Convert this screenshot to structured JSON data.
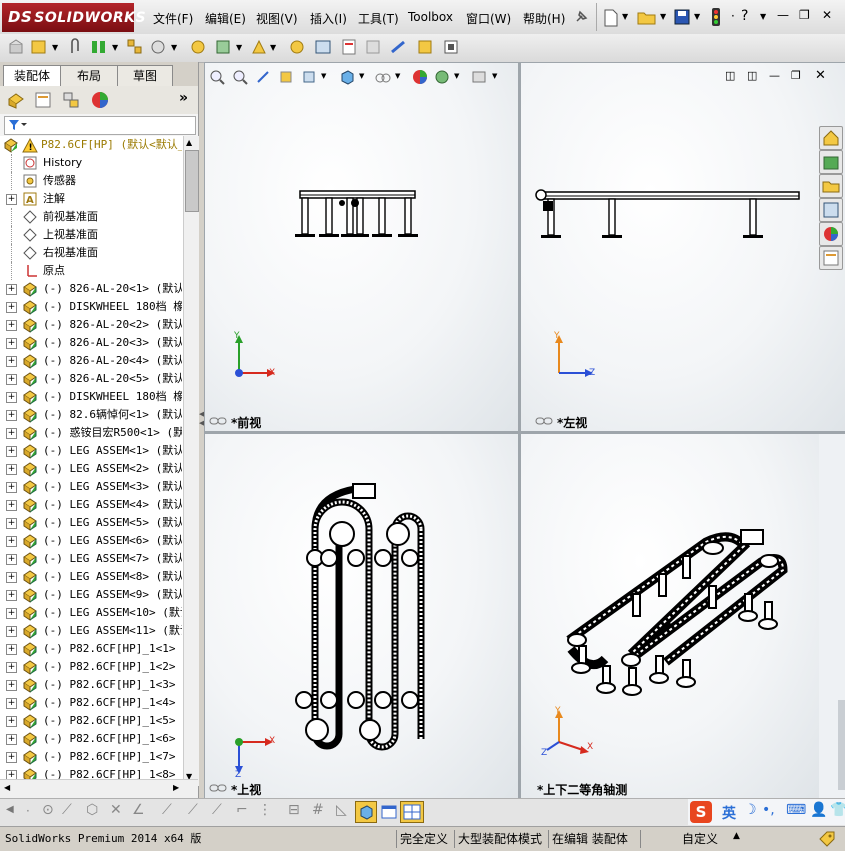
{
  "app": {
    "brand": "SOLIDWORKS",
    "brand_prefix": "DS"
  },
  "menu": [
    {
      "label": "文件(F)"
    },
    {
      "label": "编辑(E)"
    },
    {
      "label": "视图(V)"
    },
    {
      "label": "插入(I)"
    },
    {
      "label": "工具(T)"
    },
    {
      "label": "Toolbox"
    },
    {
      "label": "窗口(W)"
    },
    {
      "label": "帮助(H)"
    }
  ],
  "window_controls": {
    "help": "?",
    "minimize": "—",
    "restore": "❐",
    "close": "✕"
  },
  "panel_tabs": [
    {
      "label": "装配体"
    },
    {
      "label": "布局"
    },
    {
      "label": "草图"
    }
  ],
  "panel_more": "»",
  "tree": {
    "root": "P82.6CF[HP]  (默认<默认_",
    "items": [
      {
        "label": "History",
        "icon": "history-icon",
        "expand": ""
      },
      {
        "label": "传感器",
        "icon": "sensor-icon",
        "expand": ""
      },
      {
        "label": "注解",
        "icon": "annotation-icon",
        "expand": "+"
      },
      {
        "label": "前视基准面",
        "icon": "plane-icon",
        "expand": ""
      },
      {
        "label": "上视基准面",
        "icon": "plane-icon",
        "expand": ""
      },
      {
        "label": "右视基准面",
        "icon": "plane-icon",
        "expand": ""
      },
      {
        "label": "原点",
        "icon": "origin-icon",
        "expand": ""
      },
      {
        "label": "(-) 826-AL-20<1> (默认<",
        "icon": "part-icon",
        "expand": "+"
      },
      {
        "label": "(-) DISKWHEEL 180档 橡胶",
        "icon": "part-icon",
        "expand": "+"
      },
      {
        "label": "(-) 826-AL-20<2> (默认<",
        "icon": "part-icon",
        "expand": "+"
      },
      {
        "label": "(-) 826-AL-20<3> (默认<",
        "icon": "part-icon",
        "expand": "+"
      },
      {
        "label": "(-) 826-AL-20<4> (默认<",
        "icon": "part-icon",
        "expand": "+"
      },
      {
        "label": "(-) 826-AL-20<5> (默认<",
        "icon": "part-icon",
        "expand": "+"
      },
      {
        "label": "(-) DISKWHEEL 180档 橡胶",
        "icon": "part-icon",
        "expand": "+"
      },
      {
        "label": "(-) 82.6辆悼何<1> (默认",
        "icon": "part-icon",
        "expand": "+"
      },
      {
        "label": "(-) 惑铵目宏R500<1> (默",
        "icon": "part-icon",
        "expand": "+"
      },
      {
        "label": "(-) LEG ASSEM<1> (默认<",
        "icon": "part-icon",
        "expand": "+"
      },
      {
        "label": "(-) LEG ASSEM<2> (默认<",
        "icon": "part-icon",
        "expand": "+"
      },
      {
        "label": "(-) LEG ASSEM<3> (默认<",
        "icon": "part-icon",
        "expand": "+"
      },
      {
        "label": "(-) LEG ASSEM<4> (默认<",
        "icon": "part-icon",
        "expand": "+"
      },
      {
        "label": "(-) LEG ASSEM<5> (默认<",
        "icon": "part-icon",
        "expand": "+"
      },
      {
        "label": "(-) LEG ASSEM<6> (默认<",
        "icon": "part-icon",
        "expand": "+"
      },
      {
        "label": "(-) LEG ASSEM<7> (默认<",
        "icon": "part-icon",
        "expand": "+"
      },
      {
        "label": "(-) LEG ASSEM<8> (默认<",
        "icon": "part-icon",
        "expand": "+"
      },
      {
        "label": "(-) LEG ASSEM<9> (默认<",
        "icon": "part-icon",
        "expand": "+"
      },
      {
        "label": "(-) LEG ASSEM<10> (默认",
        "icon": "part-icon",
        "expand": "+"
      },
      {
        "label": "(-) LEG ASSEM<11> (默认",
        "icon": "part-icon",
        "expand": "+"
      },
      {
        "label": "(-) P82.6CF[HP]_1<1> (默",
        "icon": "part-icon",
        "expand": "+"
      },
      {
        "label": "(-) P82.6CF[HP]_1<2> (默",
        "icon": "part-icon",
        "expand": "+"
      },
      {
        "label": "(-) P82.6CF[HP]_1<3> (默",
        "icon": "part-icon",
        "expand": "+"
      },
      {
        "label": "(-) P82.6CF[HP]_1<4> (默",
        "icon": "part-icon",
        "expand": "+"
      },
      {
        "label": "(-) P82.6CF[HP]_1<5> (默",
        "icon": "part-icon",
        "expand": "+"
      },
      {
        "label": "(-) P82.6CF[HP]_1<6> (默",
        "icon": "part-icon",
        "expand": "+"
      },
      {
        "label": "(-) P82.6CF[HP]_1<7> (默",
        "icon": "part-icon",
        "expand": "+"
      },
      {
        "label": "(-) P82.6CF[HP]_1<8> (默",
        "icon": "part-icon",
        "expand": "+"
      }
    ]
  },
  "viewports": [
    {
      "label": "*前视",
      "axes": [
        "Y",
        "X"
      ]
    },
    {
      "label": "*左视",
      "axes": [
        "Y",
        "Z"
      ]
    },
    {
      "label": "*上视",
      "axes": [
        "X",
        "Z"
      ]
    },
    {
      "label": "*上下二等角轴测",
      "axes": [
        "Y",
        "X",
        "Z"
      ]
    }
  ],
  "status": {
    "product": "SolidWorks Premium 2014 x64 版",
    "defined": "完全定义",
    "mode": "大型装配体模式",
    "editing": "在编辑 装配体",
    "custom": "自定义",
    "custom_arrow": "▲"
  },
  "ime": {
    "lang": "英",
    "brand": "S"
  },
  "colors": {
    "brand_red": "#a8181d",
    "axis_x": "#d62a1e",
    "axis_y": "#2aa02a",
    "axis_z": "#2b50d6",
    "selection_blue": "#316ac5"
  }
}
